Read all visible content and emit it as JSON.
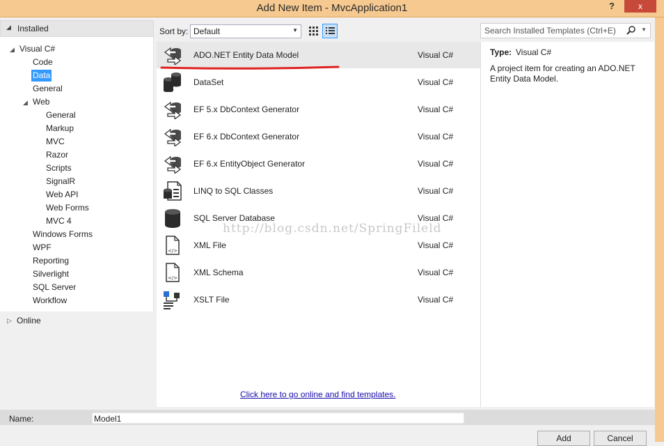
{
  "window": {
    "title": "Add New Item - MvcApplication1",
    "help_label": "?",
    "close_label": "x"
  },
  "left": {
    "installed": "Installed",
    "tree": {
      "visual_csharp": "Visual C#",
      "code": "Code",
      "data": "Data",
      "general": "General",
      "web": "Web",
      "web_general": "General",
      "markup": "Markup",
      "mvc": "MVC",
      "razor": "Razor",
      "scripts": "Scripts",
      "signalr": "SignalR",
      "webapi": "Web API",
      "webforms": "Web Forms",
      "mvc4": "MVC 4",
      "windows_forms": "Windows Forms",
      "wpf": "WPF",
      "reporting": "Reporting",
      "silverlight": "Silverlight",
      "sql_server": "SQL Server",
      "workflow": "Workflow"
    },
    "online": "Online"
  },
  "toolbar": {
    "sort_label": "Sort by:",
    "sort_value": "Default",
    "search_placeholder": "Search Installed Templates (Ctrl+E)"
  },
  "templates": [
    {
      "name": "ADO.NET Entity Data Model",
      "lang": "Visual C#",
      "icon": "entity-model-icon"
    },
    {
      "name": "DataSet",
      "lang": "Visual C#",
      "icon": "dataset-icon"
    },
    {
      "name": "EF 5.x DbContext Generator",
      "lang": "Visual C#",
      "icon": "ef-generator-icon"
    },
    {
      "name": "EF 6.x DbContext Generator",
      "lang": "Visual C#",
      "icon": "ef-generator-icon"
    },
    {
      "name": "EF 6.x EntityObject Generator",
      "lang": "Visual C#",
      "icon": "ef-generator-icon"
    },
    {
      "name": "LINQ to SQL Classes",
      "lang": "Visual C#",
      "icon": "linq-sql-icon"
    },
    {
      "name": "SQL Server Database",
      "lang": "Visual C#",
      "icon": "database-icon"
    },
    {
      "name": "XML File",
      "lang": "Visual C#",
      "icon": "xml-file-icon"
    },
    {
      "name": "XML Schema",
      "lang": "Visual C#",
      "icon": "xml-schema-icon"
    },
    {
      "name": "XSLT File",
      "lang": "Visual C#",
      "icon": "xslt-file-icon"
    }
  ],
  "watermark": "http://blog.csdn.net/SpringFileld",
  "online_link": "Click here to go online and find templates.",
  "detail": {
    "type_label": "Type:",
    "type_value": "Visual C#",
    "description": "A project item for creating an ADO.NET Entity Data Model."
  },
  "bottom": {
    "name_label": "Name:",
    "name_value": "Model1",
    "add_label": "Add",
    "cancel_label": "Cancel"
  },
  "colors": {
    "title_bar": "#f5c98f",
    "close_button": "#c7493a",
    "selection": "#3399ff",
    "annotation": "#e02020"
  }
}
